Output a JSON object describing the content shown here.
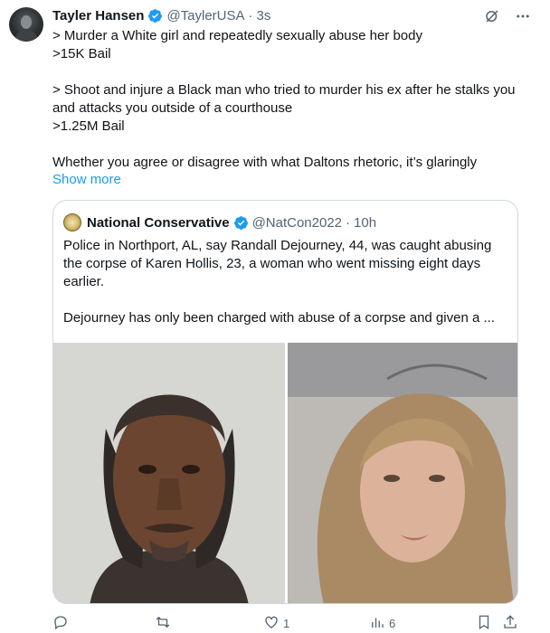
{
  "tweet": {
    "author_name": "Tayler Hansen",
    "author_handle": "@TaylerUSA",
    "separator": "·",
    "time": "3s",
    "lines": [
      "> Murder a White girl and repeatedly sexually abuse her body",
      ">15K Bail",
      "> Shoot and injure a Black man who tried to murder his ex after he stalks you and attacks you outside of a courthouse",
      ">1.25M Bail",
      "Whether you agree or disagree with what Daltons rhetoric, it’s glaringly"
    ],
    "show_more": "Show more"
  },
  "quote": {
    "author_name": "National Conservative",
    "author_handle": "@NatCon2022",
    "separator": "·",
    "time": "10h",
    "paragraph1": "Police in Northport, AL, say Randall Dejourney, 44, was caught abusing the corpse of Karen Hollis, 23, a woman who went missing eight days earlier.",
    "paragraph2": "Dejourney has only been charged with abuse of a corpse and given a ..."
  },
  "actions": {
    "reply_count": "",
    "retweet_count": "",
    "like_count": "1",
    "views_count": "6"
  },
  "icons": {
    "top": [
      "grok-icon",
      "more-icon"
    ],
    "bottom": [
      "reply-icon",
      "retweet-icon",
      "like-icon",
      "views-icon",
      "bookmark-icon",
      "share-icon"
    ]
  },
  "colors": {
    "link": "#1d9bf0",
    "verified": "#1d9bf0",
    "secondary_text": "#536471",
    "border": "#cfd9de"
  }
}
